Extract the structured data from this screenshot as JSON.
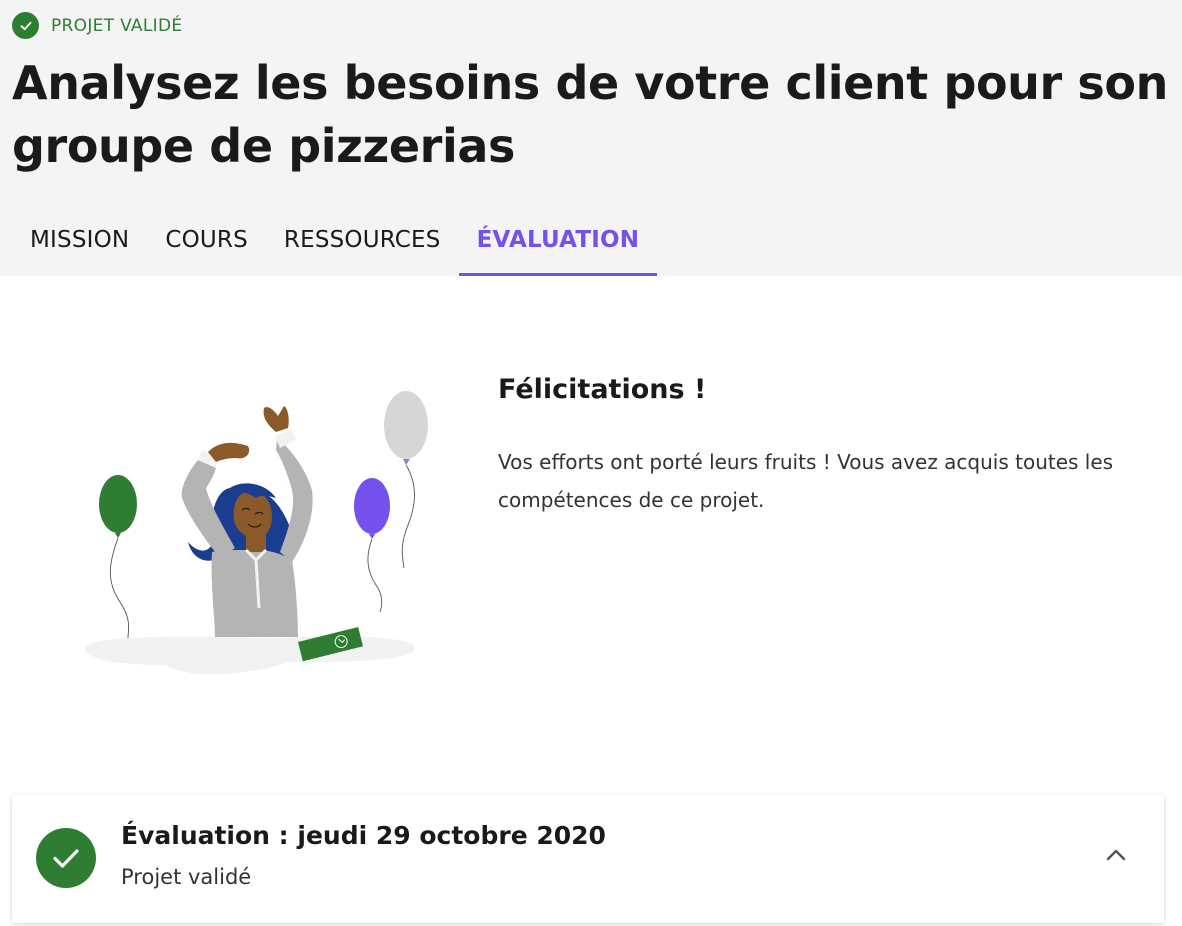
{
  "header": {
    "status": {
      "label": "PROJET VALIDÉ",
      "icon": "check-icon",
      "color": "#2e7d32"
    },
    "title": "Analysez les besoins de votre client pour son groupe de pizzerias"
  },
  "tabs": [
    {
      "label": "MISSION",
      "active": false
    },
    {
      "label": "COURS",
      "active": false
    },
    {
      "label": "RESSOURCES",
      "active": false
    },
    {
      "label": "ÉVALUATION",
      "active": true
    }
  ],
  "congratulations": {
    "title": "Félicitations !",
    "text": "Vos efforts ont porté leurs fruits ! Vous avez acquis toutes les compétences de ce projet."
  },
  "evaluation": {
    "title": "Évaluation : jeudi 29 octobre 2020",
    "status": "Projet validé",
    "icon": "check-circle-icon",
    "toggle_icon": "chevron-up-icon"
  },
  "colors": {
    "accent": "#7451eb",
    "success": "#2e7d32",
    "header_bg": "#f4f4f4"
  }
}
